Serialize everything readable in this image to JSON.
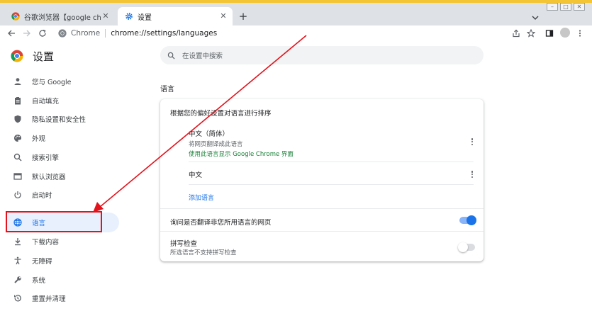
{
  "browser": {
    "tabs": [
      {
        "title": "谷歌浏览器【google chrome】",
        "active": false,
        "icon": "chrome-logo-icon"
      },
      {
        "title": "设置",
        "active": true,
        "icon": "gear-icon"
      }
    ],
    "address_chip": "Chrome",
    "url": "chrome://settings/languages",
    "accent_color": "#f3c535"
  },
  "settings": {
    "title": "设置",
    "search_placeholder": "在设置中搜索",
    "sidebar": [
      {
        "label": "您与 Google",
        "icon": "person-icon"
      },
      {
        "label": "自动填充",
        "icon": "clipboard-icon"
      },
      {
        "label": "隐私设置和安全性",
        "icon": "shield-icon"
      },
      {
        "label": "外观",
        "icon": "palette-icon"
      },
      {
        "label": "搜索引擎",
        "icon": "search-icon"
      },
      {
        "label": "默认浏览器",
        "icon": "browser-window-icon"
      },
      {
        "label": "启动时",
        "icon": "power-icon"
      },
      {
        "label": "语言",
        "icon": "globe-icon",
        "active": true
      },
      {
        "label": "下载内容",
        "icon": "download-icon"
      },
      {
        "label": "无障碍",
        "icon": "accessibility-icon"
      },
      {
        "label": "系统",
        "icon": "wrench-icon"
      },
      {
        "label": "重置并清理",
        "icon": "restore-icon"
      }
    ],
    "section_title": "语言",
    "card": {
      "heading": "根据您的偏好设置对语言进行排序",
      "languages": [
        {
          "name": "中文（简体）",
          "sub": "将网页翻译成此语言",
          "link": "使用此语言显示 Google Chrome 界面"
        },
        {
          "name": "中文"
        }
      ],
      "add_language": "添加语言",
      "translate_label": "询问是否翻译非您所用语言的网页",
      "translate_enabled": true,
      "spellcheck_label": "拼写检查",
      "spellcheck_sub": "所选语言不支持拼写检查",
      "spellcheck_enabled": false
    }
  },
  "annotation": {
    "color": "#e3131d"
  }
}
